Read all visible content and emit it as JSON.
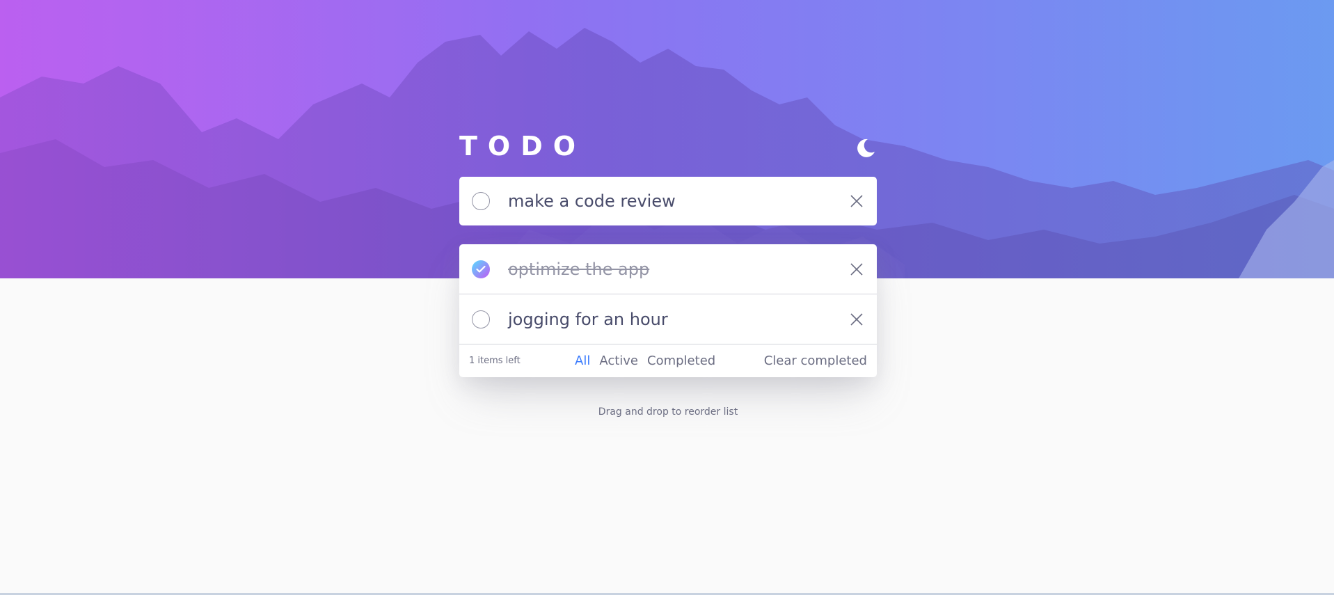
{
  "app": {
    "title": "TODO",
    "theme_toggle_icon": "moon-icon"
  },
  "new_todo": {
    "value": "make a code review"
  },
  "todos": [
    {
      "text": "optimize the app",
      "completed": true
    },
    {
      "text": "jogging for an hour",
      "completed": false
    }
  ],
  "footer": {
    "items_left": "1 items left",
    "filters": [
      "All",
      "Active",
      "Completed"
    ],
    "active_filter": "All",
    "clear_label": "Clear completed"
  },
  "hint": "Drag and drop to reorder list",
  "colors": {
    "accent": "#3a7bfd",
    "check_gradient_start": "#57ddff",
    "check_gradient_end": "#c058f3",
    "text": "#484b6a",
    "muted": "#9394a5",
    "background": "#fafafa"
  }
}
